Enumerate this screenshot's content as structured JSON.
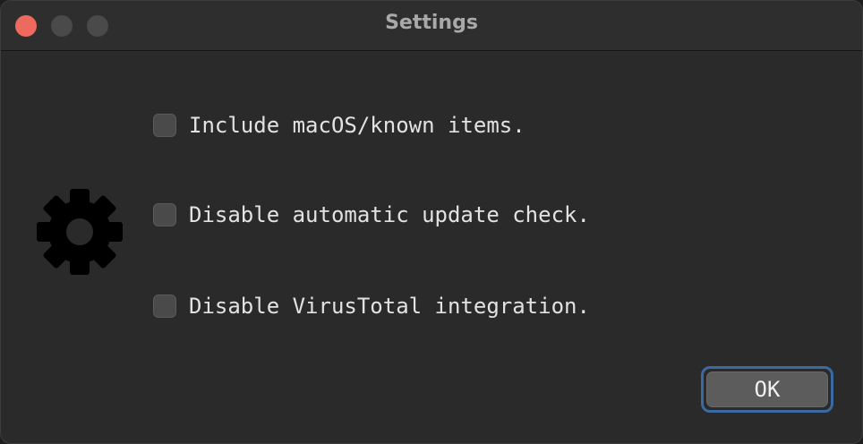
{
  "window": {
    "title": "Settings"
  },
  "icon": "gear-icon",
  "options": [
    {
      "label": "Include macOS/known items.",
      "checked": false
    },
    {
      "label": "Disable automatic update check.",
      "checked": false
    },
    {
      "label": "Disable VirusTotal integration.",
      "checked": false
    }
  ],
  "buttons": {
    "ok_label": "OK"
  },
  "colors": {
    "close": "#ee6a5e",
    "focus_ring": "#3b6aa3"
  }
}
